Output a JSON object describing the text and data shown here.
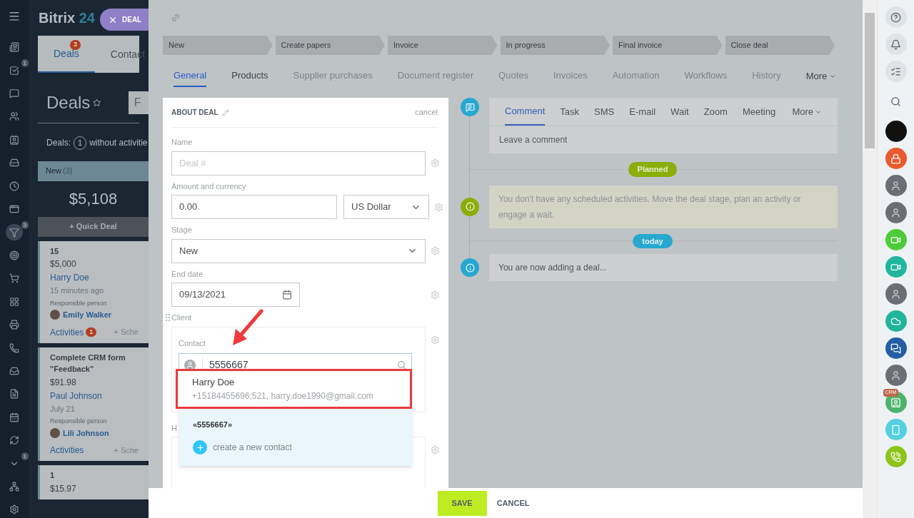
{
  "app": {
    "logo": "Bitrix",
    "logo_accent": "24",
    "close_tab": "DEAL"
  },
  "nav": [
    {
      "kind": "feed"
    },
    {
      "kind": "tasks",
      "badge": "1"
    },
    {
      "kind": "chat"
    },
    {
      "kind": "groups"
    },
    {
      "kind": "contacts"
    },
    {
      "kind": "drive"
    },
    {
      "kind": "time"
    },
    {
      "kind": "sites"
    },
    {
      "kind": "crm",
      "badge": "3",
      "selected": true
    },
    {
      "kind": "target"
    },
    {
      "kind": "shop"
    },
    {
      "kind": "apps"
    },
    {
      "kind": "register"
    },
    {
      "kind": "phone"
    },
    {
      "kind": "inbox"
    },
    {
      "kind": "doc"
    },
    {
      "kind": "calendar"
    },
    {
      "kind": "sync"
    },
    {
      "kind": "more",
      "badge": "1"
    },
    {
      "kind": "sitemap"
    },
    {
      "kind": "settings"
    }
  ],
  "crm_tabs": [
    {
      "label": "Deals",
      "badge": "3",
      "selected": true
    },
    {
      "label": "Contact",
      "selected": false
    }
  ],
  "page_title": "Deals",
  "filter_stub": "F",
  "deals_summary": {
    "label": "Deals:",
    "count": "1",
    "text": "without activitie"
  },
  "column": {
    "name": "New",
    "count": "(3)",
    "total": "$5,108",
    "quick_deal": "+ Quick Deal"
  },
  "cards": [
    {
      "title": "15",
      "amount": "$5,000",
      "client": "Harry Doe",
      "time": "15 minutes ago",
      "responsible_label": "Responsible person",
      "responsible": "Emily Walker",
      "activities": "Activities",
      "activities_badge": "1",
      "schedule": "+ Sche"
    },
    {
      "title": "Complete CRM form \"Feedback\"",
      "amount": "$91.98",
      "client": "Paul Johnson",
      "time": "July 21",
      "responsible_label": "Responsible person",
      "responsible": "Lili Johnson",
      "activities": "Activities",
      "schedule": "+ Sche"
    },
    {
      "title": "1",
      "amount": "$15.97"
    }
  ],
  "stages": [
    "New",
    "Create papers",
    "Invoice",
    "In progress",
    "Final invoice",
    "Close deal"
  ],
  "detail_tabs": [
    {
      "label": "General",
      "selected": true,
      "disabled": false
    },
    {
      "label": "Products",
      "selected": false,
      "disabled": false
    },
    {
      "label": "Supplier purchases",
      "selected": false,
      "disabled": true
    },
    {
      "label": "Document register",
      "selected": false,
      "disabled": true
    },
    {
      "label": "Quotes",
      "selected": false,
      "disabled": true
    },
    {
      "label": "Invoices",
      "selected": false,
      "disabled": true
    },
    {
      "label": "Automation",
      "selected": false,
      "disabled": true
    },
    {
      "label": "Workflows",
      "selected": false,
      "disabled": true
    },
    {
      "label": "History",
      "selected": false,
      "disabled": true
    }
  ],
  "detail_more": "More",
  "form": {
    "title": "ABOUT DEAL",
    "cancel": "cancel",
    "fields": [
      {
        "kind": "text",
        "label": "Name",
        "placeholder": "Deal #"
      },
      {
        "kind": "money",
        "label": "Amount and currency",
        "value": "0.00",
        "currency": "US Dollar"
      },
      {
        "kind": "select",
        "label": "Stage",
        "value": "New"
      },
      {
        "kind": "date",
        "label": "End date",
        "value": "09/13/2021"
      }
    ],
    "client_label": "Client",
    "contact_label": "Contact",
    "contact_value": "5556667",
    "next_label": "H"
  },
  "dropdown": {
    "results": [
      {
        "name": "Harry Doe",
        "details": "+15184455696;521, harry.doe1990@gmail.com",
        "highlighted": true
      }
    ],
    "query": "«5556667»",
    "create": "create a new contact"
  },
  "timeline": {
    "tabs": [
      {
        "label": "Comment",
        "selected": true
      },
      {
        "label": "Task",
        "selected": false
      },
      {
        "label": "SMS",
        "selected": false
      },
      {
        "label": "E-mail",
        "selected": false
      },
      {
        "label": "Wait",
        "selected": false
      },
      {
        "label": "Zoom",
        "selected": false
      },
      {
        "label": "Meeting",
        "selected": false
      }
    ],
    "more": "More",
    "comment_placeholder": "Leave a comment",
    "planned_label": "Planned",
    "planned_text": "You don't have any scheduled activities. Move the deal stage, plan an activity or engage a wait.",
    "today_label": "today",
    "today_text": "You are now adding a deal..."
  },
  "footer": {
    "save": "SAVE",
    "cancel": "CANCEL"
  },
  "right_bar": [
    {
      "kind": "help"
    },
    {
      "kind": "bell"
    },
    {
      "kind": "list"
    },
    {
      "kind": "search"
    },
    {
      "kind": "logo"
    },
    {
      "kind": "lock"
    },
    {
      "kind": "avatar"
    },
    {
      "kind": "avatar"
    },
    {
      "kind": "video"
    },
    {
      "kind": "video2"
    },
    {
      "kind": "avatar"
    },
    {
      "kind": "cloud"
    },
    {
      "kind": "group"
    },
    {
      "kind": "avatar"
    },
    {
      "kind": "crm",
      "badge": "CRM"
    },
    {
      "kind": "mobile"
    },
    {
      "kind": "call"
    }
  ]
}
